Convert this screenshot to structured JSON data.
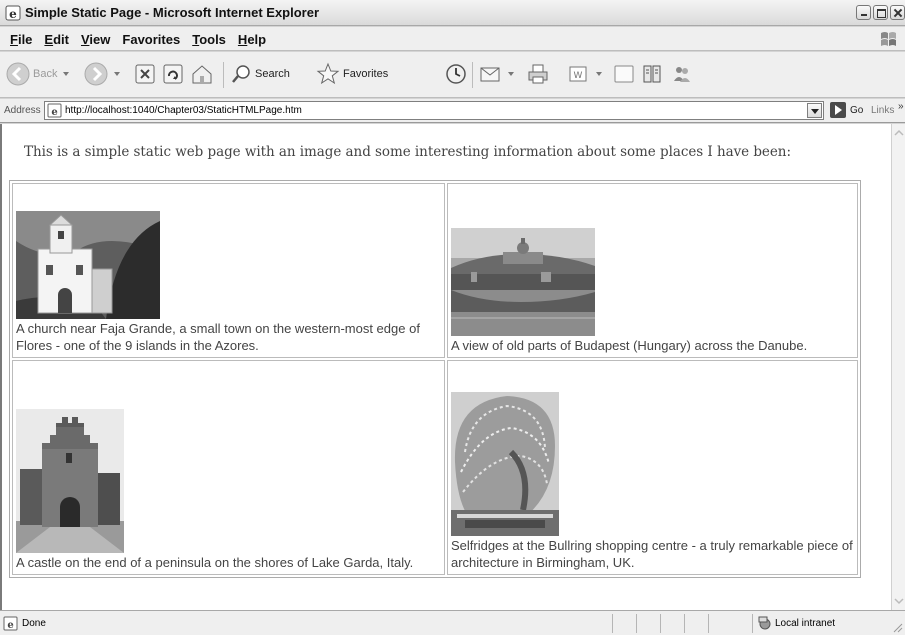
{
  "window": {
    "title": "Simple Static Page - Microsoft Internet Explorer"
  },
  "menu": [
    {
      "key": "F",
      "rest": "ile"
    },
    {
      "key": "E",
      "rest": "dit"
    },
    {
      "key": "V",
      "rest": "iew"
    },
    {
      "key": "Fa",
      "rest": "vorites"
    },
    {
      "key": "T",
      "rest": "ools"
    },
    {
      "key": "H",
      "rest": "elp"
    }
  ],
  "toolbar": {
    "back": "Back",
    "search": "Search",
    "favorites": "Favorites"
  },
  "address": {
    "label": "Address",
    "url": "http://localhost:1040/Chapter03/StaticHTMLPage.htm",
    "go": "Go",
    "links": "Links",
    "links_chevron": "»"
  },
  "page": {
    "intro": "This is a simple static web page with an image and some interesting information about some places I have been:",
    "places": [
      {
        "caption": "A church near Faja Grande, a small town on the western-most edge of Flores - one of the 9 islands in the Azores."
      },
      {
        "caption": "A view of old parts of Budapest (Hungary) across the Danube."
      },
      {
        "caption": "A castle on the end of a peninsula on the shores of Lake Garda, Italy."
      },
      {
        "caption": "Selfridges at the Bullring shopping centre - a truly remarkable piece of architecture in Birmingham, UK."
      }
    ]
  },
  "status": {
    "text": "Done",
    "zone": "Local intranet"
  }
}
